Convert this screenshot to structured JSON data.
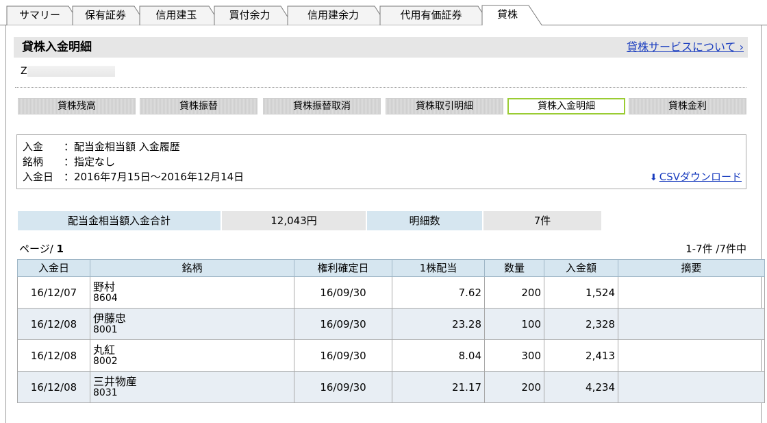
{
  "tabs": [
    {
      "label": "サマリー",
      "active": false
    },
    {
      "label": "保有証券",
      "active": false
    },
    {
      "label": "信用建玉",
      "active": false
    },
    {
      "label": "買付余力",
      "active": false
    },
    {
      "label": "信用建余力",
      "active": false
    },
    {
      "label": "代用有価証券",
      "active": false
    },
    {
      "label": "貸株",
      "active": true
    }
  ],
  "header": {
    "title": "貸株入金明細",
    "about_link": "貸株サービスについて ›"
  },
  "account": {
    "prefix": "Z"
  },
  "sub_nav": [
    {
      "label": "貸株残高",
      "active": false
    },
    {
      "label": "貸株振替",
      "active": false
    },
    {
      "label": "貸株振替取消",
      "active": false
    },
    {
      "label": "貸株取引明細",
      "active": false
    },
    {
      "label": "貸株入金明細",
      "active": true
    },
    {
      "label": "貸株金利",
      "active": false
    }
  ],
  "conditions": {
    "deposit": {
      "label": "入金",
      "value": "：配当金相当額 入金履歴"
    },
    "issue": {
      "label": "銘柄",
      "value": "：指定なし"
    },
    "date": {
      "label": "入金日",
      "value": "：2016年7月15日～2016年12月14日"
    },
    "csv_link": "CSVダウンロード"
  },
  "summary": {
    "total_label": "配当金相当額入金合計",
    "total_value": "12,043円",
    "count_label": "明細数",
    "count_value": "7件"
  },
  "paging": {
    "page_label": "ページ/",
    "page_number": "1",
    "count_text": "1-7件 /7件中"
  },
  "table": {
    "headers": [
      "入金日",
      "銘柄",
      "権利確定日",
      "1株配当",
      "数量",
      "入金額",
      "摘要"
    ],
    "rows": [
      {
        "date": "16/12/07",
        "name": "野村",
        "code": "8604",
        "record_date": "16/09/30",
        "dividend": "7.62",
        "qty": "200",
        "amount": "1,524",
        "note": ""
      },
      {
        "date": "16/12/08",
        "name": "伊藤忠",
        "code": "8001",
        "record_date": "16/09/30",
        "dividend": "23.28",
        "qty": "100",
        "amount": "2,328",
        "note": ""
      },
      {
        "date": "16/12/08",
        "name": "丸紅",
        "code": "8002",
        "record_date": "16/09/30",
        "dividend": "8.04",
        "qty": "300",
        "amount": "2,413",
        "note": ""
      },
      {
        "date": "16/12/08",
        "name": "三井物産",
        "code": "8031",
        "record_date": "16/09/30",
        "dividend": "21.17",
        "qty": "200",
        "amount": "4,234",
        "note": ""
      }
    ]
  },
  "colors": {
    "link": "#1a3dbf",
    "active_border": "#9acc33",
    "header_blue": "#d6e6f0",
    "row_alt": "#e8eef4",
    "title_bg": "#e6e6e6"
  }
}
